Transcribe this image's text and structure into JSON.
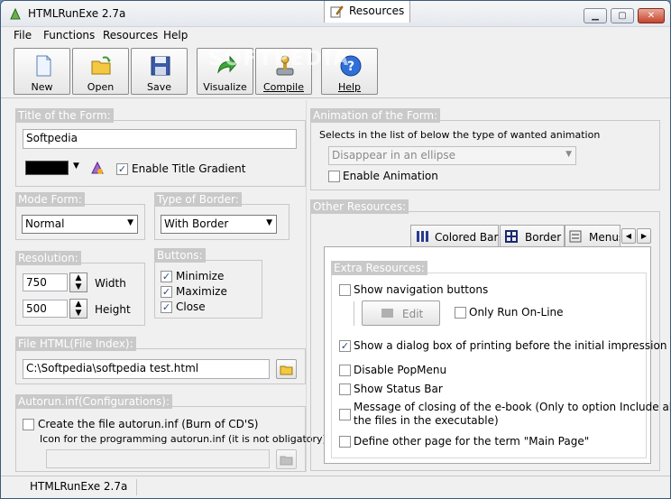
{
  "window": {
    "title": "HTMLRunExe 2.7a"
  },
  "menu": [
    "File",
    "Functions",
    "Resources",
    "Help"
  ],
  "toolbar": {
    "new": "New",
    "open": "Open",
    "save": "Save",
    "visualize": "Visualize",
    "compile": "Compile",
    "help": "Help"
  },
  "watermark": "SOFTPEDIA",
  "form_title": {
    "header": "Title of the Form:",
    "value": "Softpedia",
    "gradient_label": "Enable Title Gradient",
    "gradient_checked": true,
    "color": "#000000"
  },
  "mode_form": {
    "header": "Mode Form:",
    "value": "Normal"
  },
  "border_type": {
    "header": "Type of Border:",
    "value": "With Border"
  },
  "resolution": {
    "header": "Resolution:",
    "width_value": "750",
    "width_label": "Width",
    "height_value": "500",
    "height_label": "Height"
  },
  "buttons": {
    "header": "Buttons:",
    "items": [
      {
        "label": "Minimize",
        "checked": true
      },
      {
        "label": "Maximize",
        "checked": true
      },
      {
        "label": "Close",
        "checked": true
      }
    ]
  },
  "file_html": {
    "header": "File HTML(File Index):",
    "value": "C:\\Softpedia\\softpedia test.html"
  },
  "autorun": {
    "header": "Autorun.inf(Configurations):",
    "create_label": "Create the file autorun.inf (Burn of CD'S)",
    "icon_label": "Icon for the programming autorun.inf (it is not obligatory):"
  },
  "animation": {
    "header": "Animation of the Form:",
    "desc": "Selects in the list of below the type of wanted animation",
    "value": "Disappear in an ellipse",
    "enable_label": "Enable Animation"
  },
  "other": {
    "header": "Other Resources:",
    "tabs": [
      "Resources",
      "Colored Bar",
      "Border",
      "Menus"
    ],
    "extra_header": "Extra Resources:",
    "show_nav": "Show navigation buttons",
    "edit": "Edit",
    "only_online": "Only Run On-Line",
    "dialog_print": "Show a dialog box of printing before the initial impression",
    "disable_popmenu": "Disable PopMenu",
    "show_status": "Show Status Bar",
    "msg_closing_1": "Message of closing of the e-book (Only to option Include all",
    "msg_closing_2": "the files in the executable)",
    "define_other": "Define other page for the term \"Main Page\""
  },
  "status": "HTMLRunExe 2.7a",
  "colors": {
    "accent": "#2a4a80",
    "header_bg": "#c9c9c9"
  }
}
